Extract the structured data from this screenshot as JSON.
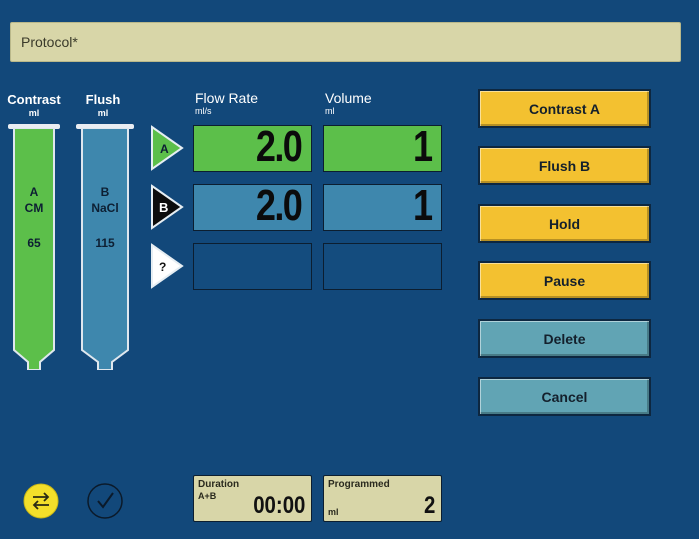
{
  "protocol": {
    "title": "Protocol*"
  },
  "syringes": {
    "contrast": {
      "label": "Contrast",
      "unit": "ml",
      "letter": "A",
      "agent": "CM",
      "volume": "65",
      "color": "#5cbf4a"
    },
    "flush": {
      "label": "Flush",
      "unit": "ml",
      "letter": "B",
      "agent": "NaCl",
      "volume": "115",
      "color": "#3e87ad"
    }
  },
  "columns": {
    "flow_rate": {
      "title": "Flow Rate",
      "unit": "ml/s"
    },
    "volume": {
      "title": "Volume",
      "unit": "ml"
    }
  },
  "phases": [
    {
      "marker": "A",
      "flow": "2.0",
      "volume": "1"
    },
    {
      "marker": "B",
      "flow": "2.0",
      "volume": "1"
    },
    {
      "marker": "?",
      "flow": "",
      "volume": ""
    }
  ],
  "buttons": {
    "contrast_a": "Contrast A",
    "flush_b": "Flush B",
    "hold": "Hold",
    "pause": "Pause",
    "delete": "Delete",
    "cancel": "Cancel"
  },
  "icons": {
    "swap": "swap-arrows-icon",
    "confirm": "checkmark-icon"
  },
  "status": {
    "duration": {
      "label": "Duration",
      "sub": "A+B",
      "value": "00:00"
    },
    "programmed": {
      "label": "Programmed",
      "unit": "ml",
      "value": "2"
    }
  },
  "colors": {
    "background": "#12487a",
    "contrast_green": "#5cbf4a",
    "flush_blue": "#3e87ad",
    "button_yellow": "#f3c130",
    "button_teal": "#61a4b4",
    "status_beige": "#d8d6a8"
  }
}
